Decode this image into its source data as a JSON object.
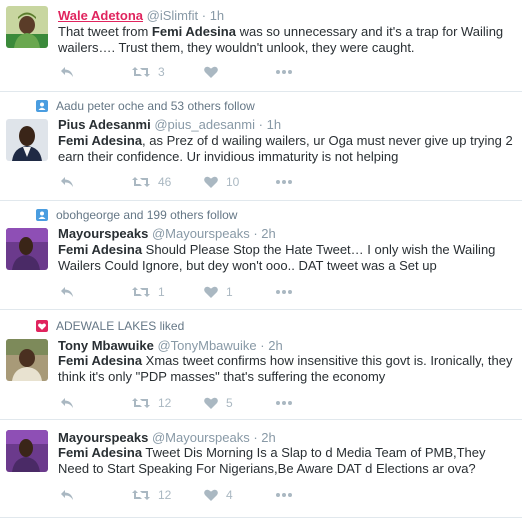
{
  "colors": {
    "accent": "#1da1f2",
    "like": "#e0245e",
    "action_icon": "#aab8c2",
    "muted": "#8899a6"
  },
  "tweets": [
    {
      "context": null,
      "name": "Wale Adetona",
      "handle": "@iSlimfit",
      "sep": "·",
      "time": "1h",
      "mention": "",
      "text_pre": "That tweet from ",
      "text_bold": "Femi Adesina",
      "text_post": " was so unnecessary and it's a trap for Wailing wailers…. Trust them, they wouldn't unlook, they were caught.",
      "retweets": "3",
      "likes": ""
    },
    {
      "context": "Aadu peter oche and 53 others follow",
      "name": "Pius Adesanmi",
      "handle": "@pius_adesanmi",
      "sep": "·",
      "time": "1h",
      "text_bold": "Femi Adesina",
      "text_post": ", as Prez of d wailing wailers, ur Oga must never give up trying 2 earn their confidence. Ur invidious immaturity is not helping",
      "retweets": "46",
      "likes": "10"
    },
    {
      "context": "obohgeorge and 199 others follow",
      "name": "Mayourspeaks",
      "handle": "@Mayourspeaks",
      "sep": "·",
      "time": "2h",
      "text_bold": "Femi Adesina",
      "text_post": " Should Please Stop the Hate Tweet… I only wish the Wailing Wailers Could Ignore, but dey won't ooo.. DAT tweet was a Set up",
      "retweets": "1",
      "likes": "1"
    },
    {
      "context": "ADEWALE LAKES liked",
      "name": "Tony Mbawuike",
      "handle": "@TonyMbawuike",
      "sep": "·",
      "time": "2h",
      "text_bold": "Femi Adesina",
      "text_post": " Xmas tweet confirms how insensitive this govt is. Ironically, they think it's only \"PDP masses\" that's suffering the economy",
      "retweets": "12",
      "likes": "5"
    },
    {
      "context": null,
      "name": "Mayourspeaks",
      "handle": "@Mayourspeaks",
      "sep": "·",
      "time": "2h",
      "text_bold": "Femi Adesina",
      "text_post": " Tweet Dis Morning Is a Slap to d Media Team of PMB,They Need to Start Speaking For Nigerians,Be Aware DAT d Elections ar ova?",
      "retweets": "12",
      "likes": "4"
    }
  ]
}
